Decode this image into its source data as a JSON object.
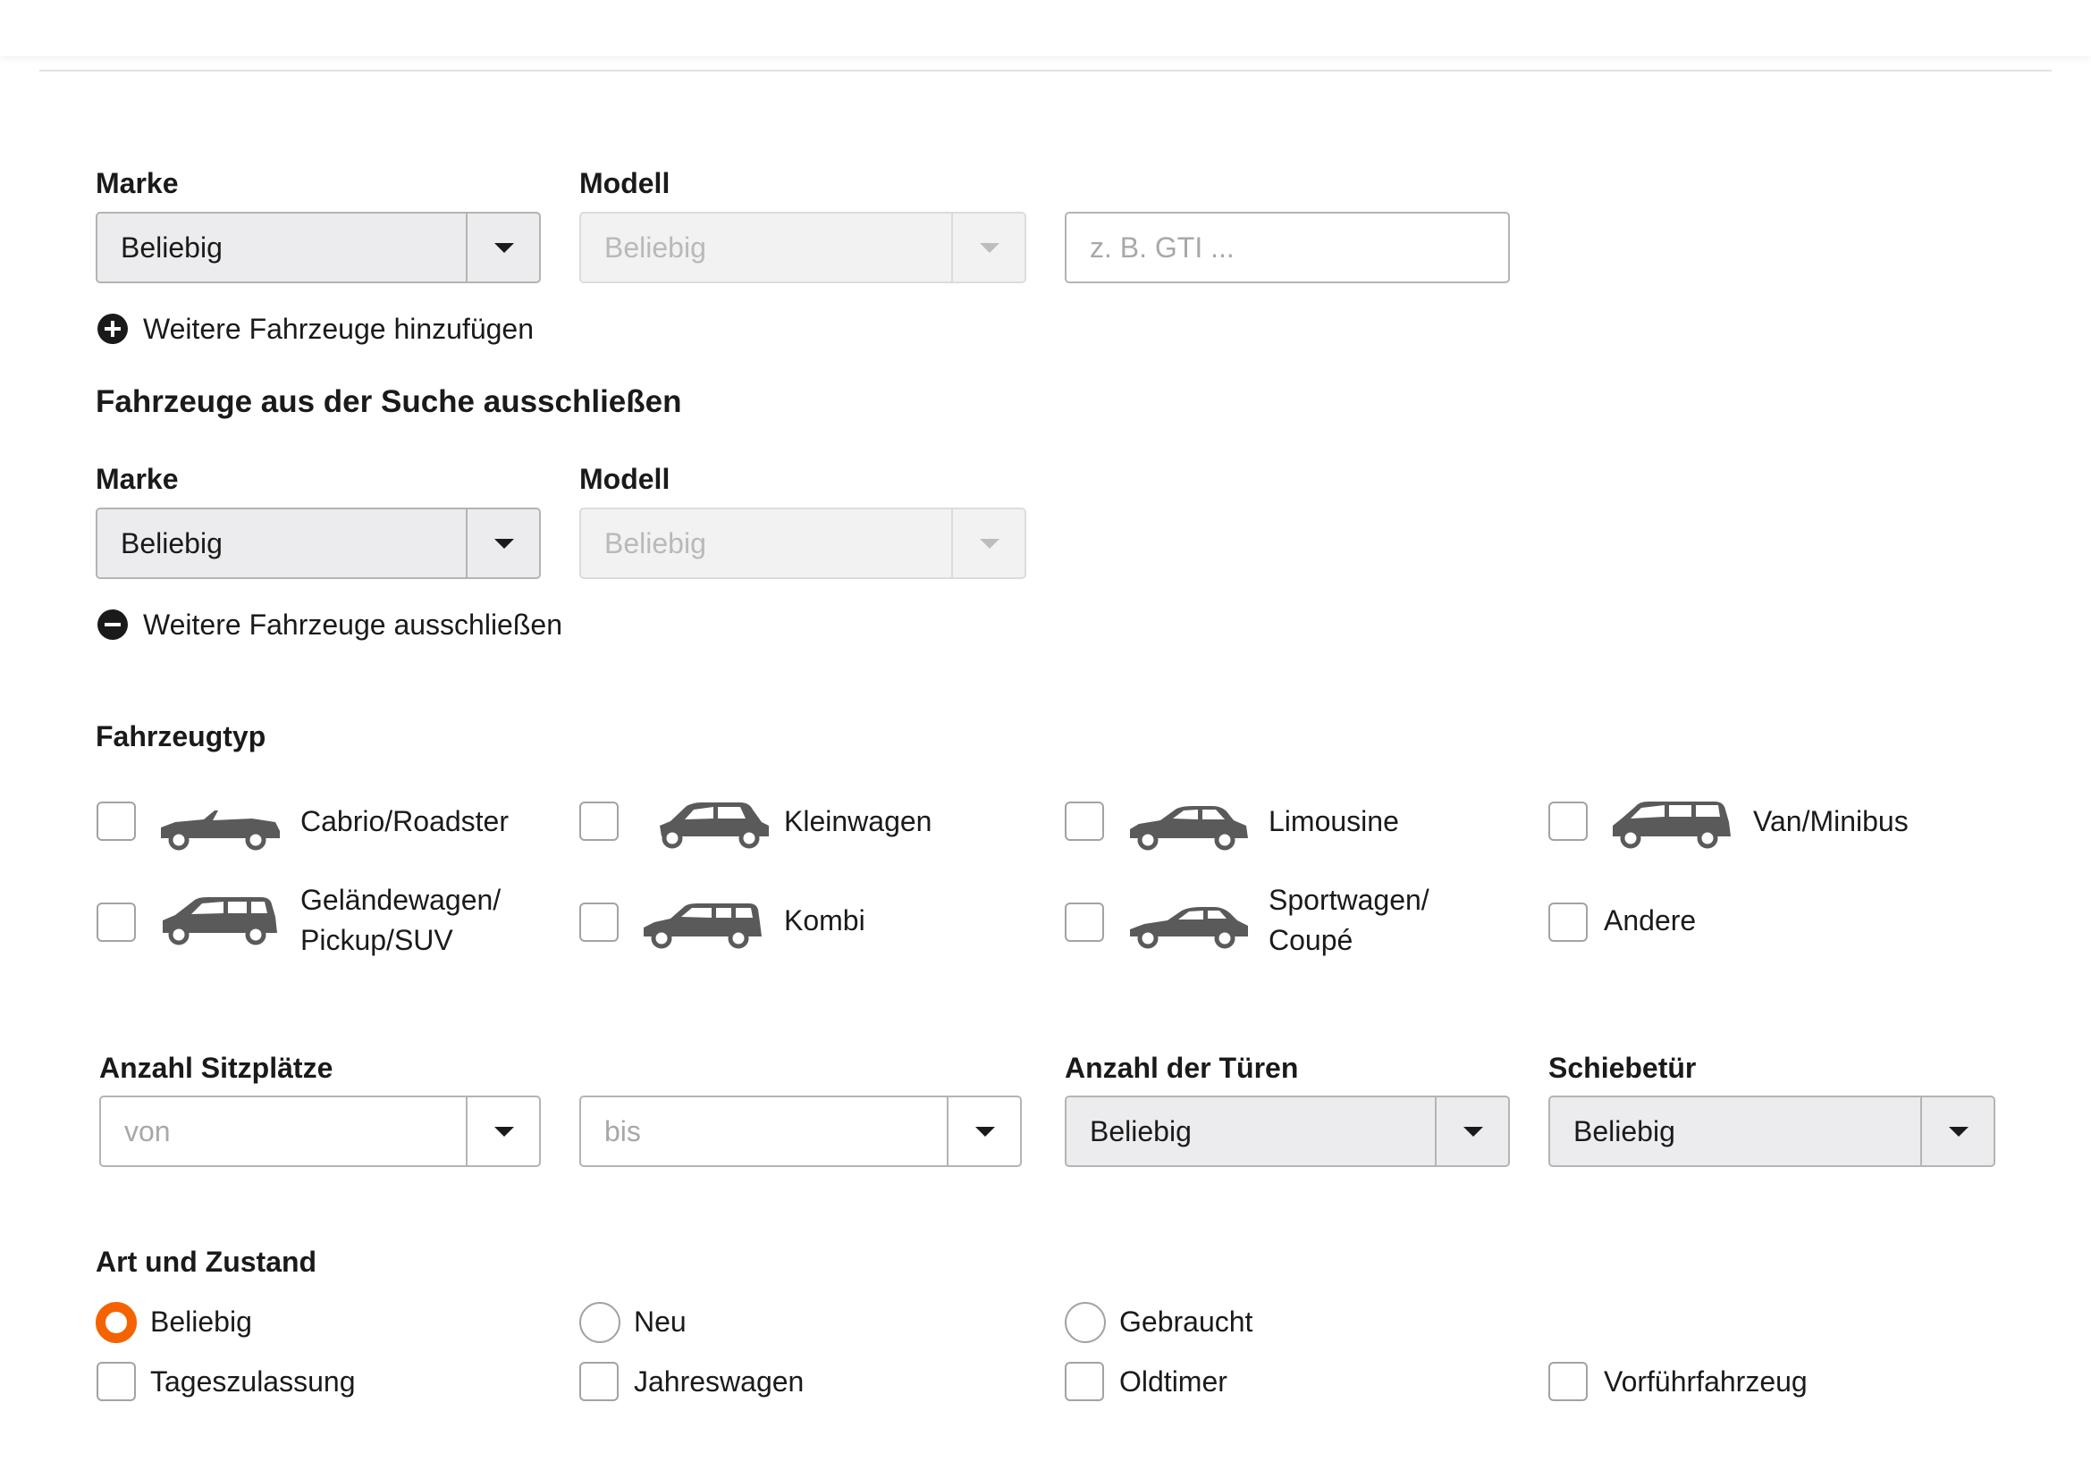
{
  "include": {
    "make_label": "Marke",
    "model_label": "Modell",
    "make_value": "Beliebig",
    "model_value": "Beliebig",
    "variant_placeholder": "z. B. GTI ...",
    "add_action": "Weitere Fahrzeuge hinzufügen"
  },
  "exclude": {
    "title": "Fahrzeuge aus der Suche ausschließen",
    "make_label": "Marke",
    "model_label": "Modell",
    "make_value": "Beliebig",
    "model_value": "Beliebig",
    "exclude_action": "Weitere Fahrzeuge ausschließen"
  },
  "vehicle_type": {
    "title": "Fahrzeugtyp",
    "options": [
      {
        "line1": "Cabrio/Roadster",
        "line2": "",
        "icon": "cabrio-icon"
      },
      {
        "line1": "Kleinwagen",
        "line2": "",
        "icon": "small-car-icon"
      },
      {
        "line1": "Limousine",
        "line2": "",
        "icon": "sedan-icon"
      },
      {
        "line1": "Van/Minibus",
        "line2": "",
        "icon": "van-icon"
      },
      {
        "line1": "Geländewagen/",
        "line2": "Pickup/SUV",
        "icon": "suv-icon"
      },
      {
        "line1": "Kombi",
        "line2": "",
        "icon": "estate-car-icon"
      },
      {
        "line1": "Sportwagen/",
        "line2": "Coupé",
        "icon": "sports-car-icon"
      },
      {
        "line1": "Andere",
        "line2": "",
        "icon": ""
      }
    ]
  },
  "seats": {
    "label": "Anzahl Sitzplätze",
    "from_value": "von",
    "to_value": "bis"
  },
  "doors": {
    "label": "Anzahl der Türen",
    "value": "Beliebig"
  },
  "sliding_door": {
    "label": "Schiebetür",
    "value": "Beliebig"
  },
  "condition": {
    "title": "Art und Zustand",
    "radios": [
      "Beliebig",
      "Neu",
      "Gebraucht"
    ],
    "selected": "Beliebig",
    "checkboxes": [
      "Tageszulassung",
      "Jahreswagen",
      "Oldtimer",
      "Vorführfahrzeug"
    ]
  },
  "colors": {
    "accent": "#f56300",
    "field_bg": "#ececee",
    "border": "#b4b4b4",
    "icon_gray": "#5a5a5a"
  }
}
